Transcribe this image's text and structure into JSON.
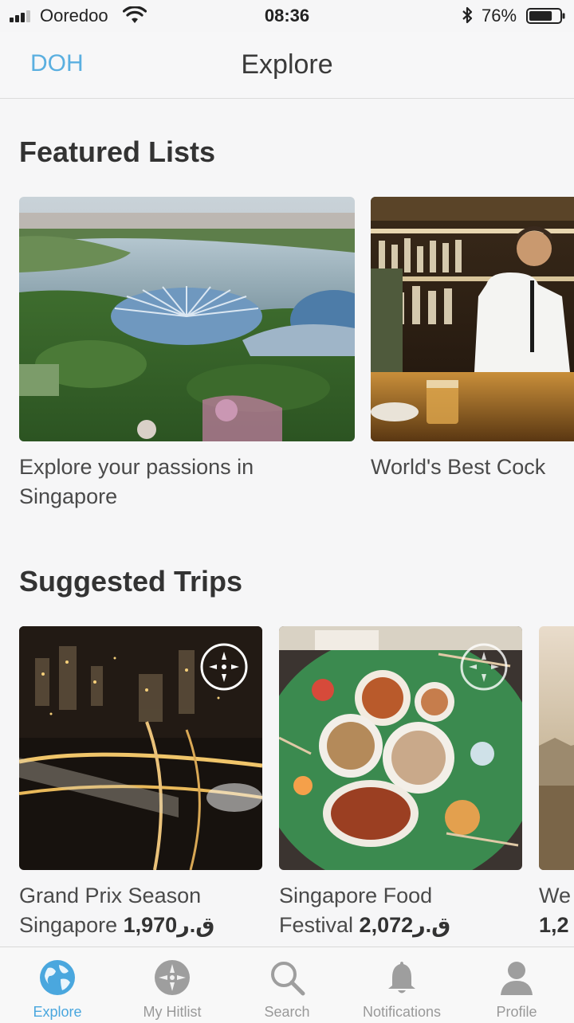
{
  "status_bar": {
    "carrier": "Ooredoo",
    "time": "08:36",
    "battery_percent": "76%",
    "battery_level": 0.76,
    "signal_bars_filled": 3,
    "signal_bars_total": 4
  },
  "nav": {
    "left_label": "DOH",
    "title": "Explore"
  },
  "featured": {
    "title": "Featured Lists",
    "items": [
      {
        "caption_line1": "Explore your passions in",
        "caption_line2": "Singapore"
      },
      {
        "caption_line1": "World's Best Cock"
      }
    ]
  },
  "trips": {
    "title": "Suggested Trips",
    "items": [
      {
        "line1": "Grand Prix Season",
        "line2_text": "Singapore",
        "price": "1,970ق.ر"
      },
      {
        "line1": "Singapore Food",
        "line2_text": "Festival",
        "price": "2,072ق.ر"
      },
      {
        "line1": "We",
        "line2_text": "1,2"
      }
    ]
  },
  "tabbar": {
    "tabs": [
      {
        "label": "Explore",
        "icon": "globe-icon",
        "active": true
      },
      {
        "label": "My Hitlist",
        "icon": "compass-icon",
        "active": false
      },
      {
        "label": "Search",
        "icon": "search-icon",
        "active": false
      },
      {
        "label": "Notifications",
        "icon": "bell-icon",
        "active": false
      },
      {
        "label": "Profile",
        "icon": "person-icon",
        "active": false
      }
    ]
  },
  "colors": {
    "accent": "#4aa7de",
    "background": "#f6f6f7",
    "text": "#333333",
    "inactive": "#999999"
  }
}
